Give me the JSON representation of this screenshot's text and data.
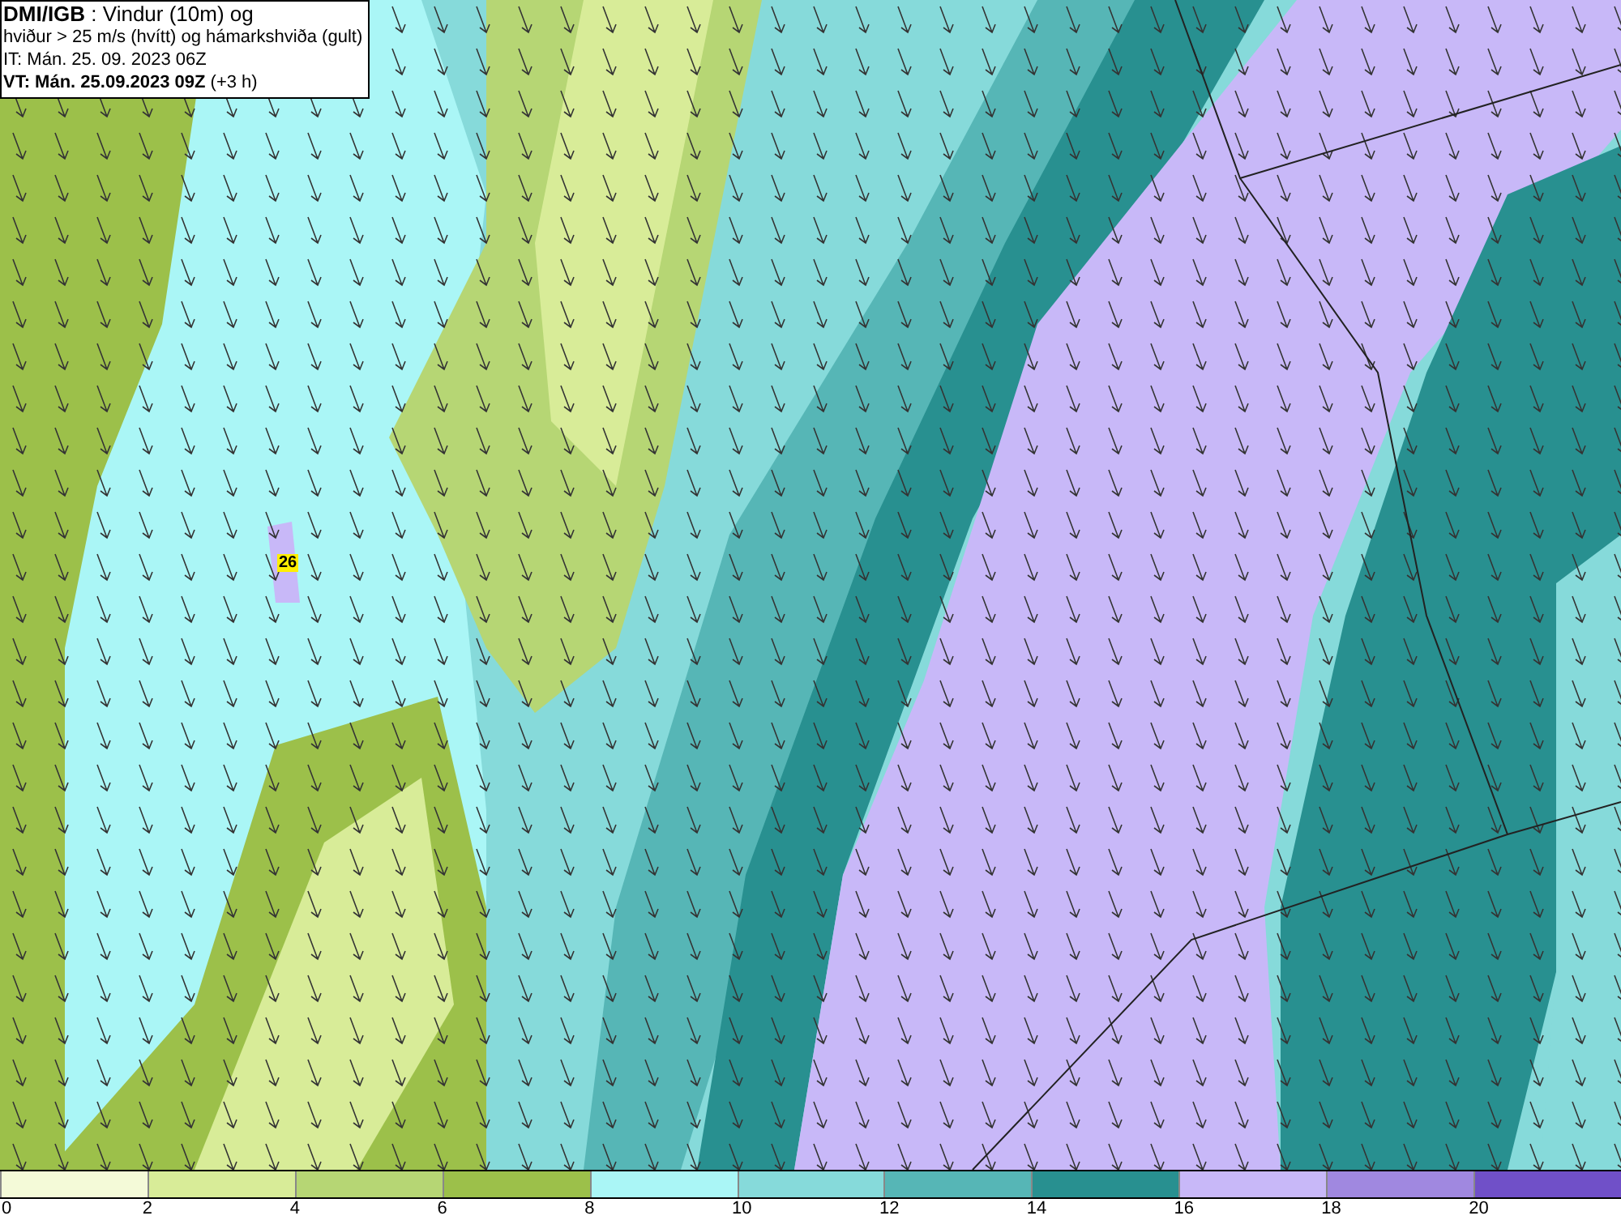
{
  "info_box": {
    "lines": [
      "**DMI/IGB** : Vindur (10m) og",
      "hviður > 25 m/s (hvítt) og hámarkshviða (gult)",
      "IT: Mán. 25. 09. 2023 06Z",
      "**VT: Mán. 25.09.2023 09Z** (+3 h)"
    ]
  },
  "max_gust_marker": {
    "value": "26"
  },
  "legend": {
    "segments": [
      {
        "color": "#f4fad8"
      },
      {
        "color": "#d8ec98"
      },
      {
        "color": "#b6d674"
      },
      {
        "color": "#9cc04a"
      },
      {
        "color": "#aaf6f6"
      },
      {
        "color": "#86dada"
      },
      {
        "color": "#56b6b6"
      },
      {
        "color": "#289090"
      },
      {
        "color": "#c8b8f8"
      },
      {
        "color": "#a088e0"
      },
      {
        "color": "#7050c8"
      }
    ],
    "ticks": [
      "0",
      "2",
      "4",
      "6",
      "8",
      "10",
      "12",
      "14",
      "16",
      "18",
      "20"
    ]
  }
}
